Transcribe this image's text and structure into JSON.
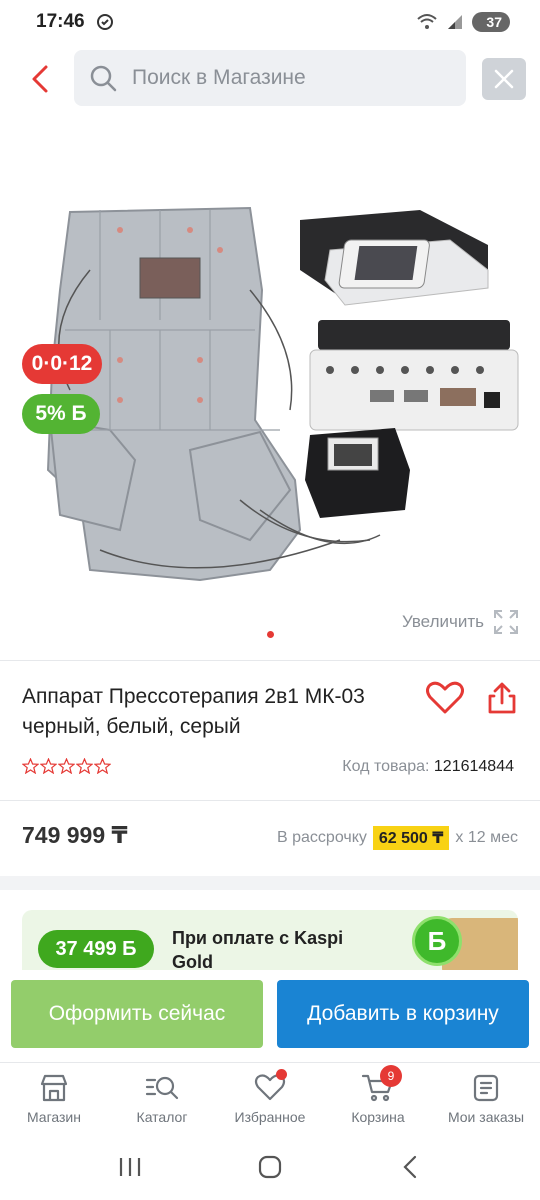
{
  "status_bar": {
    "time": "17:46",
    "battery": "37"
  },
  "header": {
    "search_placeholder": "Поиск в Магазине"
  },
  "gallery": {
    "installment_badge": "0·0·12",
    "bonus_badge": "5% Б",
    "zoom_label": "Увеличить",
    "current_slide": 1,
    "total_slides": 1
  },
  "product": {
    "title": "Аппарат Прессотерапия 2в1 МК-03 черный, белый, серый",
    "rating_stars": 0,
    "code_label": "Код товара:",
    "code_value": "121614844",
    "price": "749 999 ₸",
    "installment_prefix": "В рассрочку",
    "installment_amount": "62 500 ₸",
    "installment_suffix": "х 12 мес"
  },
  "promo": {
    "bonus_amount": "37 499 Б",
    "text": "При оплате с Kaspi Gold"
  },
  "actions": {
    "buy_now": "Оформить сейчас",
    "add_to_cart": "Добавить в корзину"
  },
  "bottom_nav": {
    "items": [
      {
        "label": "Магазин",
        "icon": "shop-icon"
      },
      {
        "label": "Каталог",
        "icon": "catalog-icon"
      },
      {
        "label": "Избранное",
        "icon": "heart-icon"
      },
      {
        "label": "Корзина",
        "icon": "cart-icon",
        "count": "9"
      },
      {
        "label": "Мои заказы",
        "icon": "orders-icon"
      }
    ]
  },
  "colors": {
    "accent_red": "#e53935",
    "bonus_green": "#53b433",
    "buy_now_green": "#93cd6b",
    "cart_blue": "#1a84d3",
    "installment_yellow": "#f8d214"
  }
}
